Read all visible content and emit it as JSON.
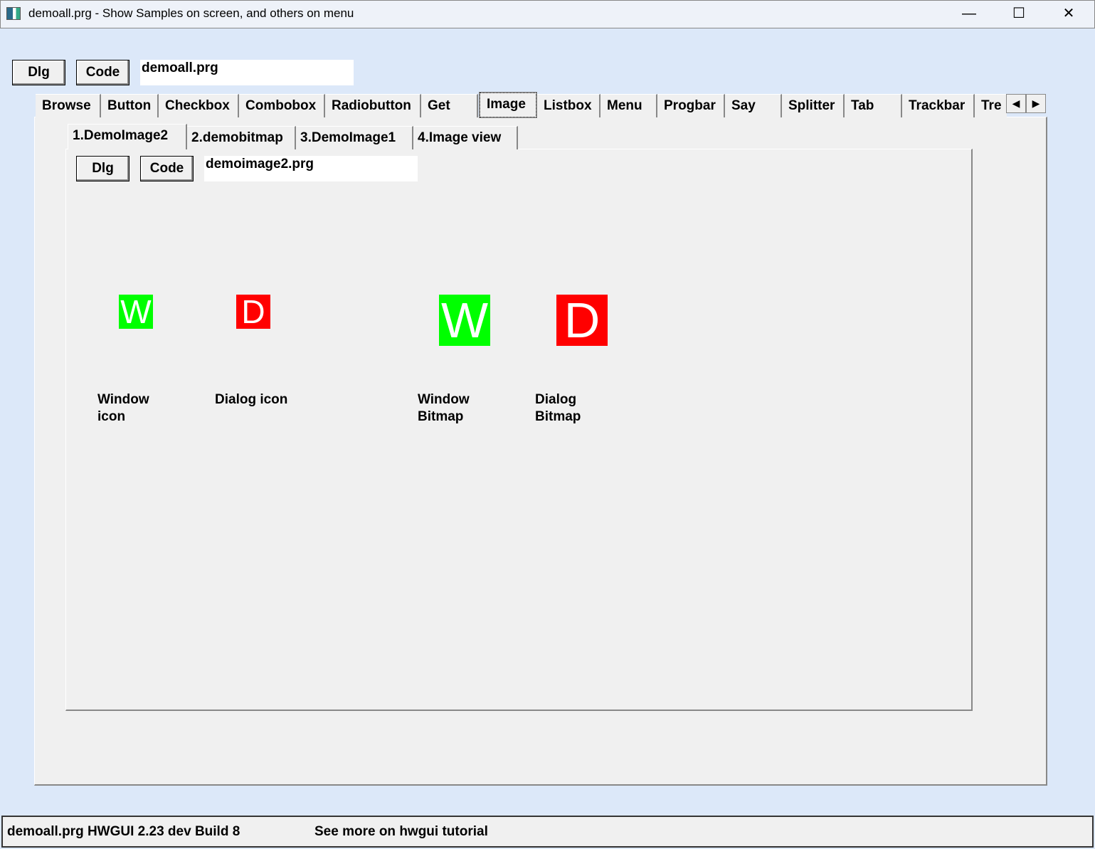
{
  "window": {
    "title": "demoall.prg - Show Samples on screen, and others on menu",
    "minimize": "—",
    "maximize": "☐",
    "close": "✕"
  },
  "top": {
    "dlg": "Dlg",
    "code": "Code",
    "file": "demoall.prg"
  },
  "tabs": [
    "Browse",
    "Button",
    "Checkbox",
    "Combobox",
    "Radiobutton",
    "Get",
    "Image",
    "Listbox",
    "Menu",
    "Progbar",
    "Say",
    "Splitter",
    "Tab",
    "Trackbar",
    "Tre"
  ],
  "selected_tab": "Image",
  "tab_scroll": {
    "left": "◀",
    "right": "▶"
  },
  "inner_tabs": [
    "1.DemoImage2",
    "2.demobitmap",
    "3.DemoImage1",
    "4.Image view"
  ],
  "inner": {
    "dlg": "Dlg",
    "code": "Code",
    "file": "demoimage2.prg"
  },
  "images": [
    {
      "glyph": "W",
      "color": "#00ff00",
      "label1": "Window",
      "label2": "icon"
    },
    {
      "glyph": "D",
      "color": "#ff0000",
      "label1": "Dialog icon",
      "label2": ""
    },
    {
      "glyph": "W",
      "color": "#00ff00",
      "label1": "Window",
      "label2": "Bitmap"
    },
    {
      "glyph": "D",
      "color": "#ff0000",
      "label1": "Dialog",
      "label2": "Bitmap"
    }
  ],
  "status": {
    "left": "demoall.prg  HWGUI 2.23 dev Build 8",
    "right": "See more on hwgui tutorial"
  }
}
